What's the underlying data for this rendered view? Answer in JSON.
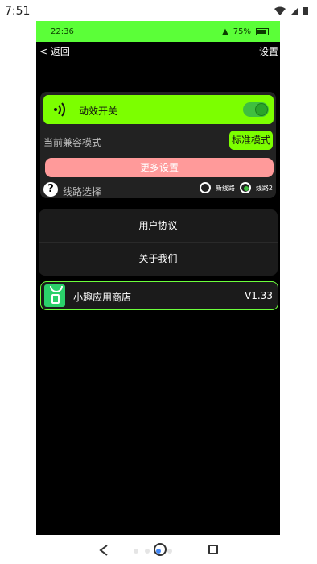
{
  "system": {
    "time": "7:51",
    "icons": [
      "wifi-icon",
      "signal-icon",
      "battery-icon"
    ]
  },
  "inner_status": {
    "time": "22:36",
    "battery": "75%"
  },
  "nav": {
    "back": "< 返回",
    "settings": "设置"
  },
  "panel": {
    "effect_label": "动效开关",
    "effect_on": true,
    "compat_label": "当前兼容模式",
    "compat_mode_button": "标准模式",
    "more_settings": "更多设置",
    "route_label": "线路选择",
    "routes": [
      {
        "label": "新线路",
        "selected": false
      },
      {
        "label": "线路2",
        "selected": true
      }
    ]
  },
  "menu": {
    "items": [
      "用户协议",
      "关于我们"
    ]
  },
  "store": {
    "name": "小趣应用商店",
    "version": "V1.33"
  },
  "colors": {
    "accent_green": "#7cff00",
    "status_green": "#5bff38",
    "pink": "#ff9a9a"
  }
}
